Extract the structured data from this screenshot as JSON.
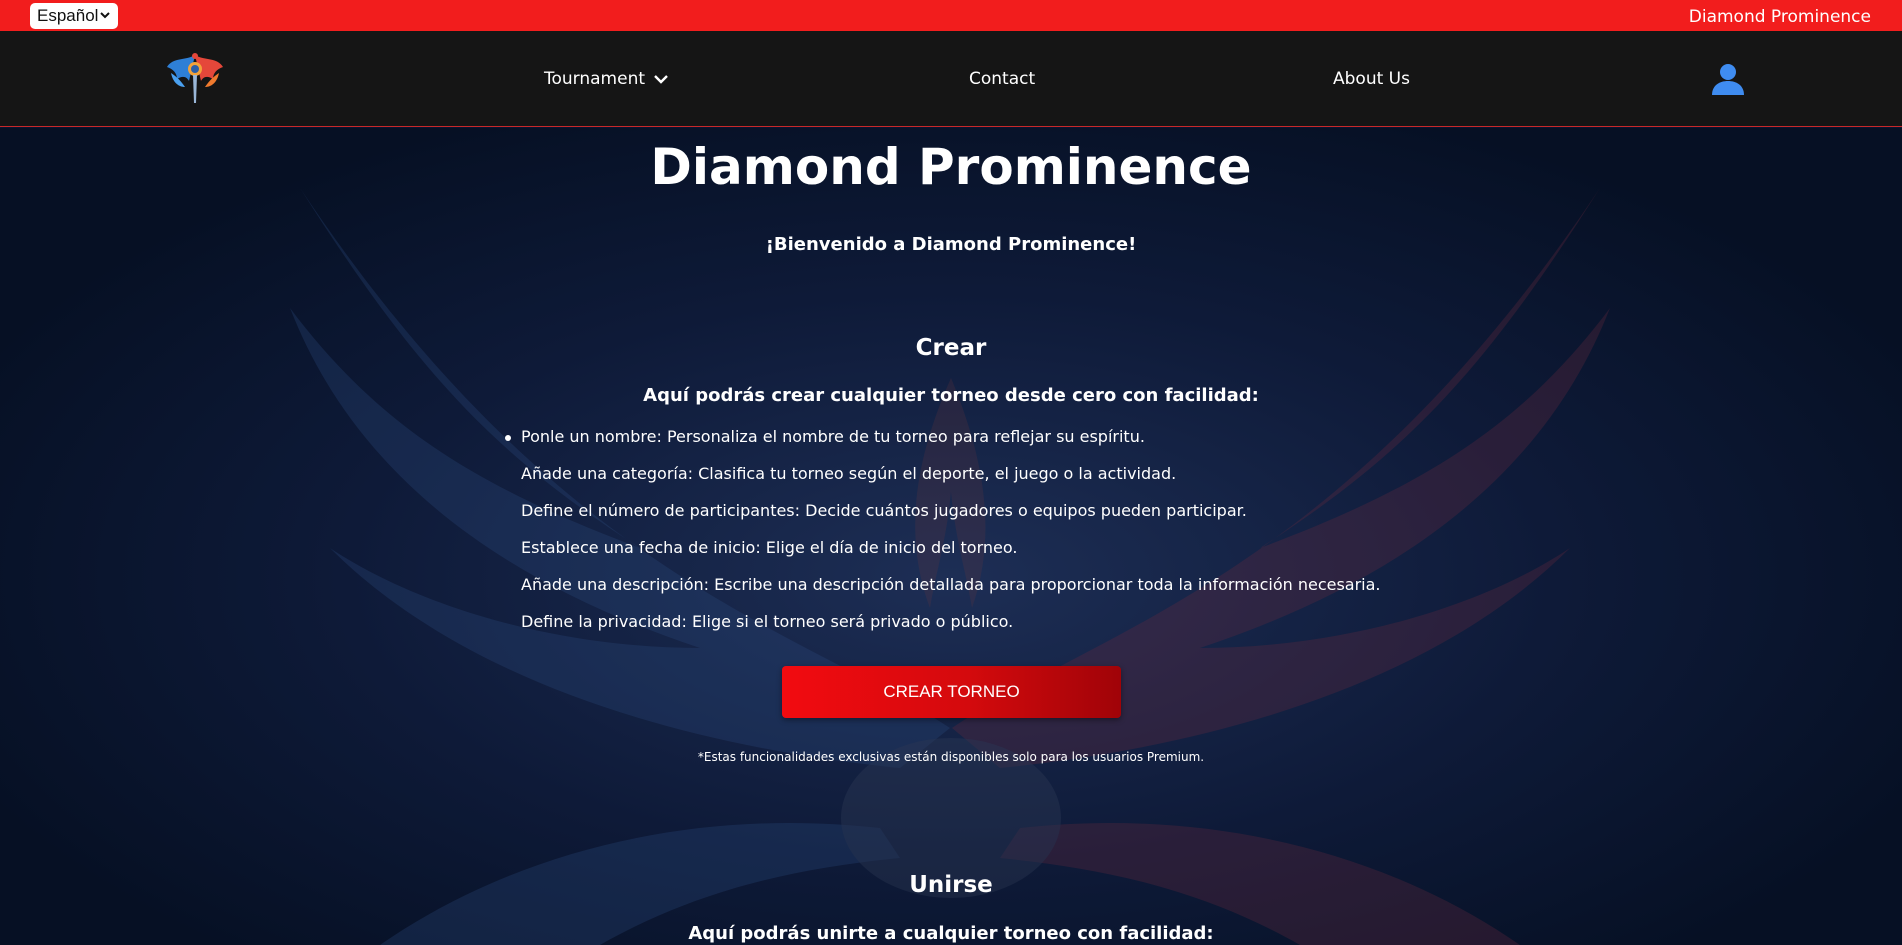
{
  "topbar": {
    "language_selected": "Español",
    "brand": "Diamond Prominence",
    "color": "#f21d1d"
  },
  "nav": {
    "logo_icon": "phoenix-logo-icon",
    "items": [
      {
        "label": "Tournament",
        "has_dropdown": true
      },
      {
        "label": "Contact"
      },
      {
        "label": "About Us"
      }
    ],
    "user_icon": "user-icon"
  },
  "main": {
    "title": "Diamond Prominence",
    "welcome": "¡Bienvenido a Diamond Prominence!",
    "create": {
      "title": "Crear",
      "subtitle": "Aquí podrás crear cualquier torneo desde cero con facilidad:",
      "items": [
        "Ponle un nombre: Personaliza el nombre de tu torneo para reflejar su espíritu.",
        "Añade una categoría: Clasifica tu torneo según el deporte, el juego o la actividad.",
        "Define el número de participantes: Decide cuántos jugadores o equipos pueden participar.",
        "Establece una fecha de inicio: Elige el día de inicio del torneo.",
        "Añade una descripción: Escribe una descripción detallada para proporcionar toda la información necesaria.",
        "Define la privacidad: Elige si el torneo será privado o público."
      ],
      "button_label": "CREAR TORNEO",
      "note": "*Estas funcionalidades exclusivas están disponibles solo para los usuarios Premium."
    },
    "join": {
      "title": "Unirse",
      "subtitle": "Aquí podrás unirte a cualquier torneo con facilidad:"
    }
  },
  "colors": {
    "accent": "#e5090e",
    "nav_bg": "#151515",
    "bg": "#0a1530"
  }
}
